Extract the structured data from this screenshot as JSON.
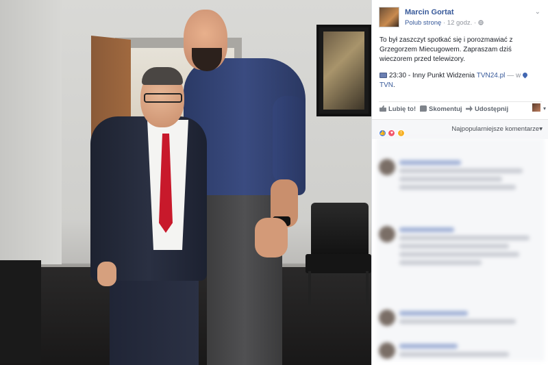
{
  "post": {
    "page_name": "Marcin Gortat",
    "like_page": "Polub stronę",
    "time": "12 godz.",
    "separator": "·",
    "privacy_icon": "globe-icon",
    "text": "To był zaszczyt spotkać się i porozmawiać z Grzegorzem Miecugowem. Zapraszam dziś wieczorem przed telewizory.",
    "program_time": "23:30",
    "program_dash": "-",
    "program_name": "Inny Punkt Widzenia",
    "program_channel": "TVN24.pl",
    "program_with": "— w",
    "program_location": "TVN",
    "program_end": "."
  },
  "actions": {
    "like": "Lubię to!",
    "comment": "Skomentuj",
    "share": "Udostępnij"
  },
  "reactions": {
    "types": [
      "like",
      "love",
      "wow"
    ],
    "sort_label": "Najpopularniejsze komentarze",
    "sort_chevron": "▾"
  },
  "icons": {
    "menu_chevron": "⌄"
  },
  "colors": {
    "link": "#365899",
    "like": "#4a7fe0",
    "love": "#f25268",
    "wow": "#f7b125"
  }
}
